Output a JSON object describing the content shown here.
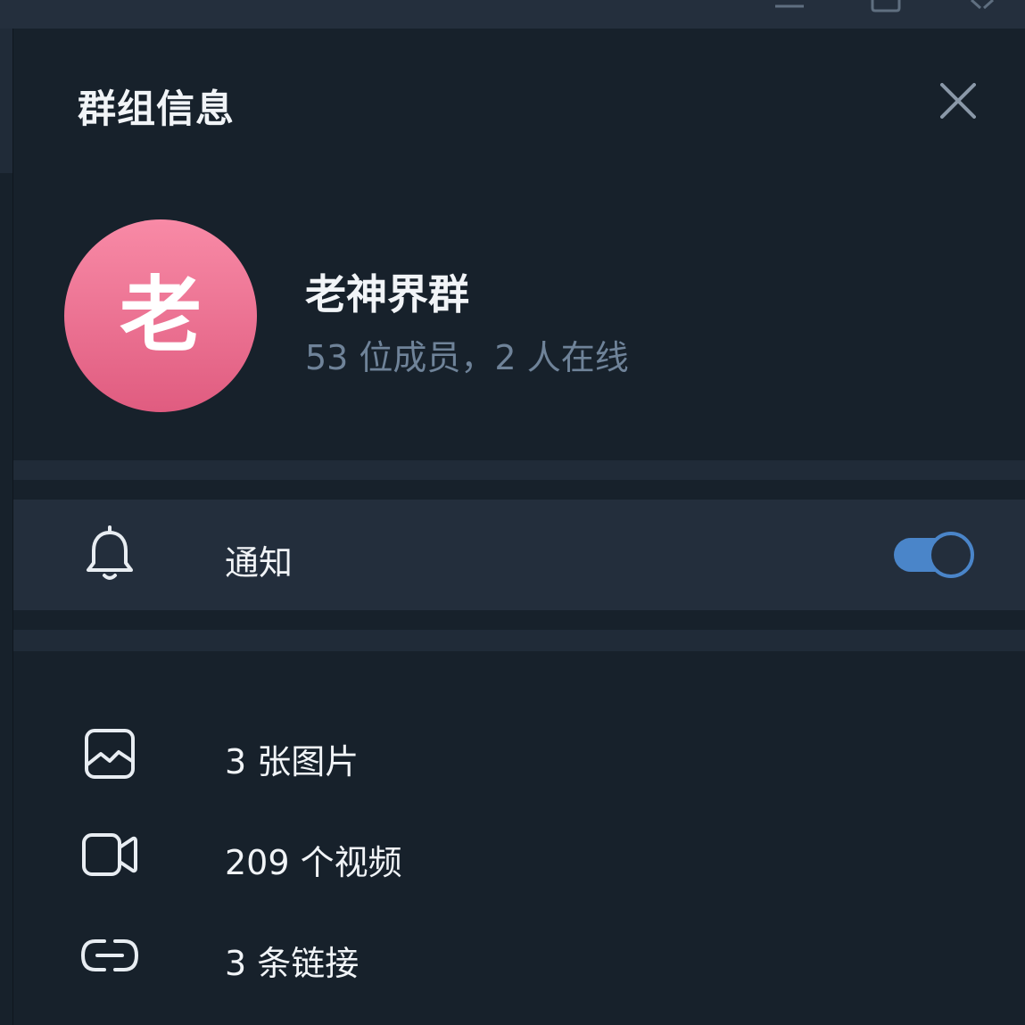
{
  "header": {
    "title": "群组信息",
    "close_icon": "close-icon"
  },
  "window_controls": [
    "minimize-icon",
    "maximize-icon",
    "close-icon"
  ],
  "group": {
    "avatar_letter": "老",
    "avatar_color_top": "#f88aa6",
    "avatar_color_bottom": "#e05c80",
    "name": "老神界群",
    "status": "53 位成员，2 人在线"
  },
  "notifications": {
    "icon": "bell-icon",
    "label": "通知",
    "enabled": true,
    "accent": "#4a85c9"
  },
  "media": [
    {
      "icon": "image-icon",
      "label": "3 张图片"
    },
    {
      "icon": "video-icon",
      "label": "209 个视频"
    },
    {
      "icon": "link-icon",
      "label": "3 条链接"
    }
  ]
}
